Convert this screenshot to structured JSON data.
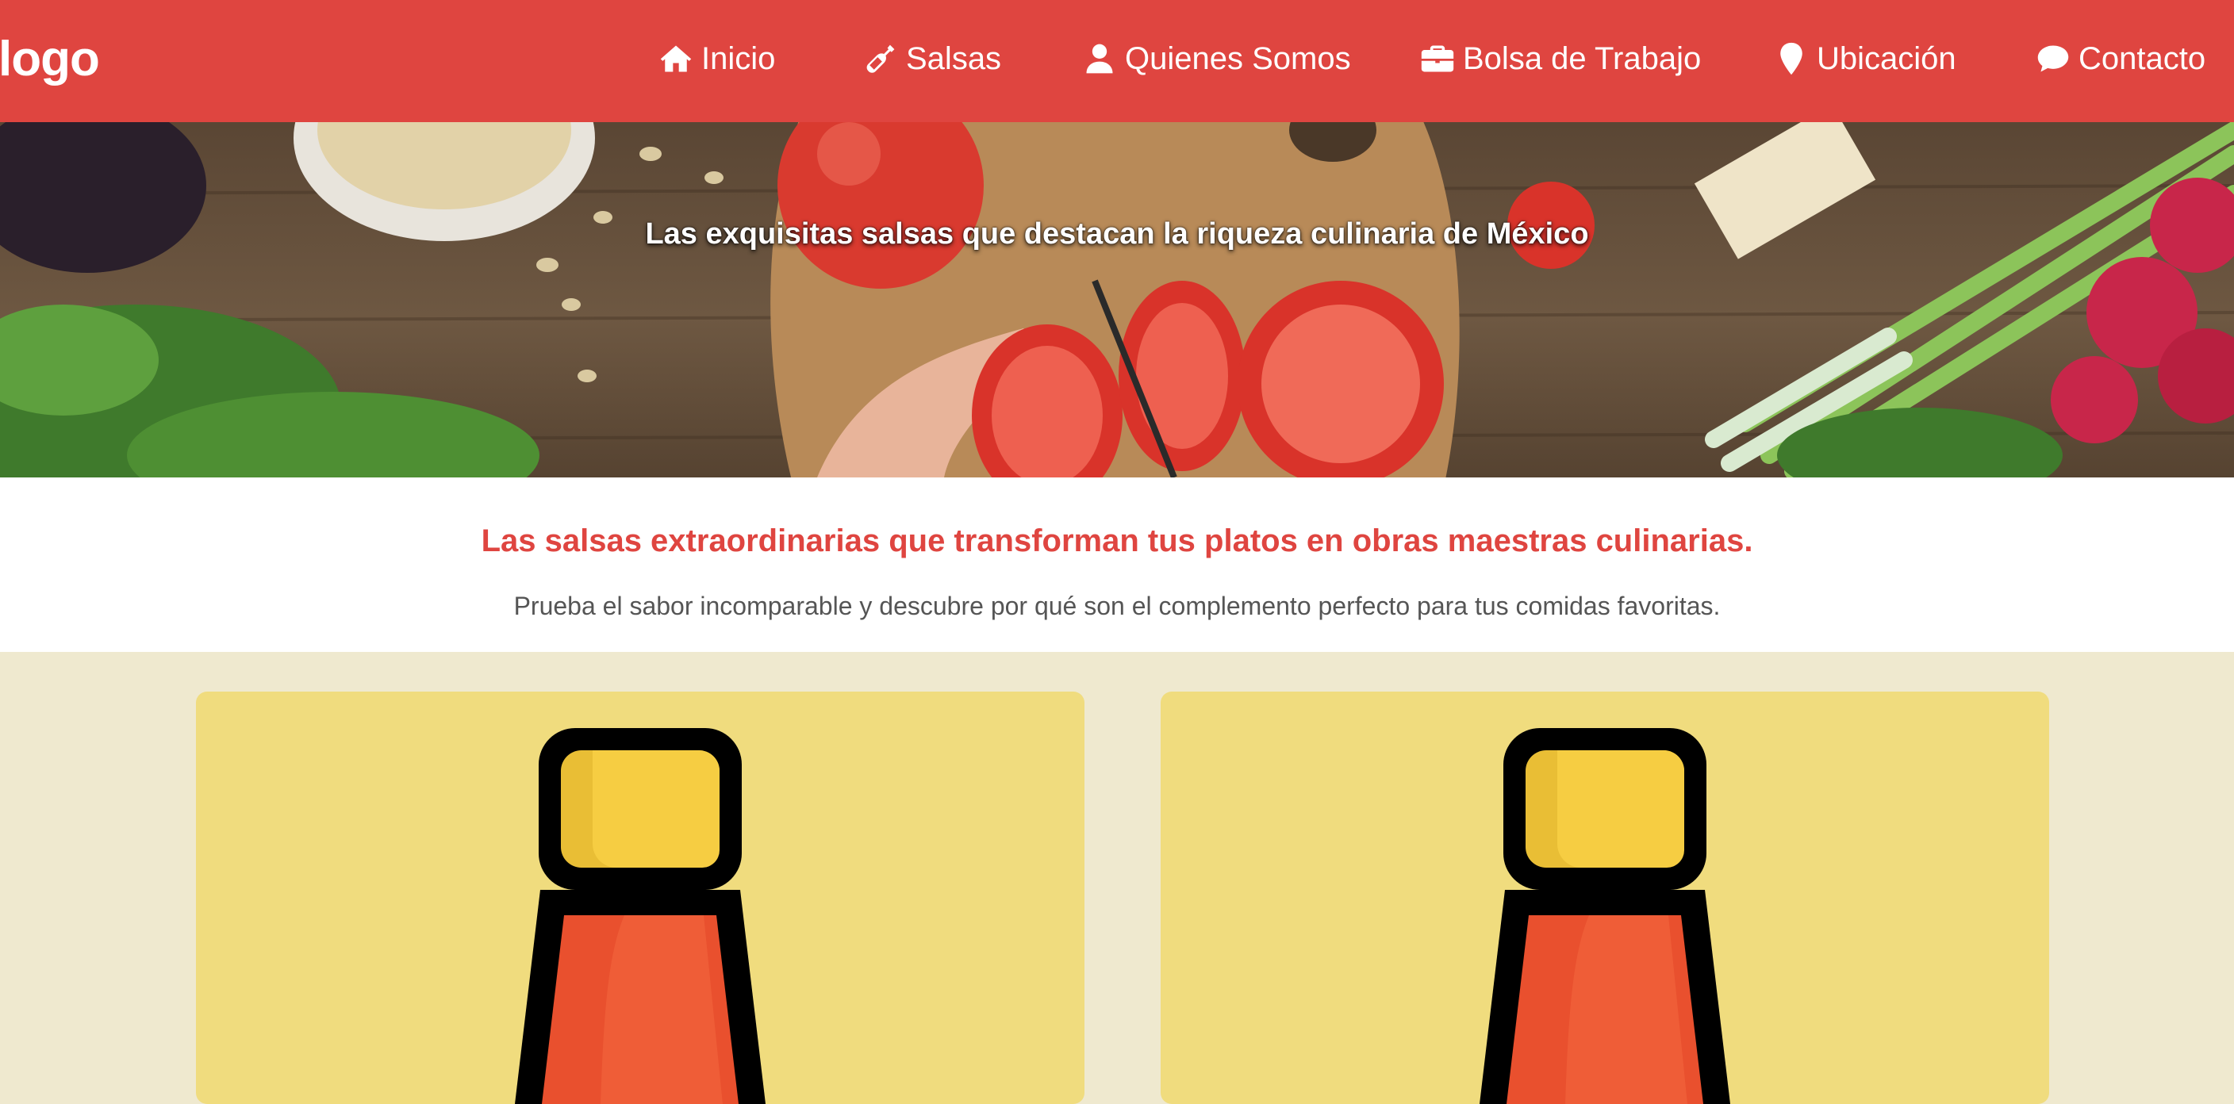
{
  "nav": {
    "logo": "logo",
    "items": [
      {
        "label": "Inicio",
        "icon": "home-icon"
      },
      {
        "label": "Salsas",
        "icon": "bottle-icon"
      },
      {
        "label": "Quienes Somos",
        "icon": "user-icon"
      },
      {
        "label": "Bolsa de Trabajo",
        "icon": "briefcase-icon"
      },
      {
        "label": "Ubicación",
        "icon": "map-pin-icon"
      },
      {
        "label": "Contacto",
        "icon": "chat-icon"
      }
    ]
  },
  "hero": {
    "title": "Las exquisitas salsas que destacan la riqueza culinaria de México"
  },
  "intro": {
    "heading": "Las salsas extraordinarias que transforman tus platos en obras maestras culinarias.",
    "subheading": "Prueba el sabor incomparable y descubre por qué son el complemento perfecto para tus comidas favoritas."
  },
  "colors": {
    "brand_red": "#df4540",
    "section_bg": "#efe9cf",
    "card_bg": "#f0dc7e"
  }
}
